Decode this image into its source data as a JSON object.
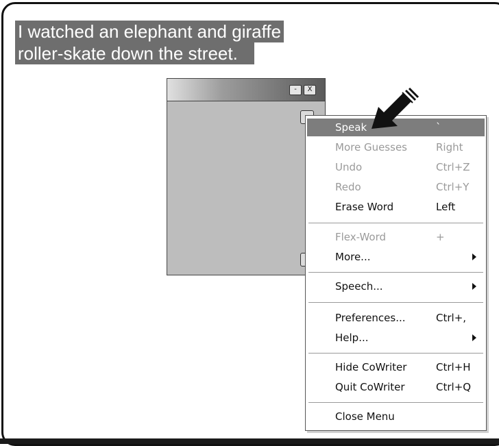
{
  "caption": {
    "line1": "I watched an elephant and giraffe",
    "line2": "roller-skate down the street."
  },
  "window": {
    "minimize_label": "-",
    "close_label": "X",
    "nav_label": "» "
  },
  "menu": {
    "speak": {
      "label": "Speak",
      "shortcut": "`"
    },
    "more_guesses": {
      "label": "More Guesses",
      "shortcut": "Right"
    },
    "undo": {
      "label": "Undo",
      "shortcut": "Ctrl+Z"
    },
    "redo": {
      "label": "Redo",
      "shortcut": "Ctrl+Y"
    },
    "erase_word": {
      "label": "Erase Word",
      "shortcut": "Left"
    },
    "flex_word": {
      "label": "Flex-Word",
      "shortcut": "+"
    },
    "more": {
      "label": "More..."
    },
    "speech": {
      "label": "Speech..."
    },
    "preferences": {
      "label": "Preferences...",
      "shortcut": "Ctrl+,"
    },
    "help": {
      "label": "Help..."
    },
    "hide": {
      "label": "Hide CoWriter",
      "shortcut": "Ctrl+H"
    },
    "quit": {
      "label": "Quit CoWriter",
      "shortcut": "Ctrl+Q"
    },
    "close_menu": {
      "label": "Close Menu"
    }
  },
  "colors": {
    "highlight": "#7d7d7d",
    "caption_bg": "#6e6e6e",
    "disabled_text": "#9a9a9a"
  }
}
